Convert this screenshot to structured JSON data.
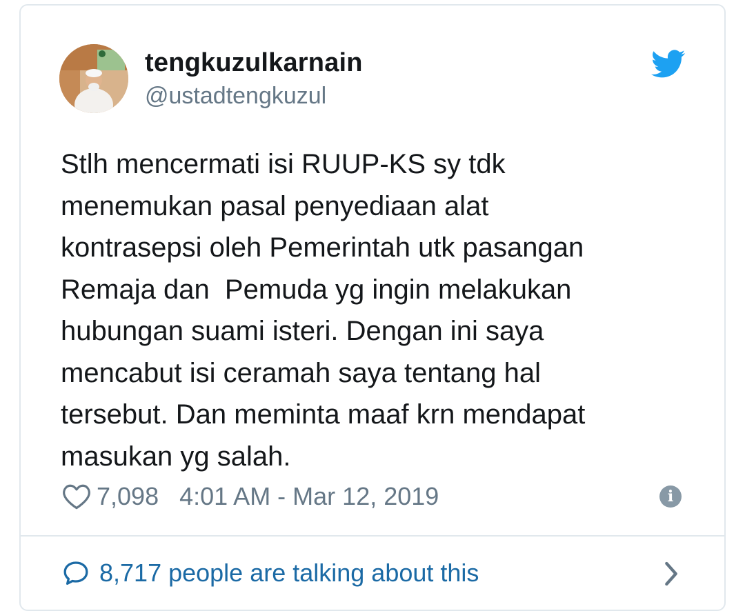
{
  "user": {
    "display_name": "tengkuzulkarnain",
    "handle": "@ustadtengkuzul",
    "avatar_icon": "profile-photo"
  },
  "tweet": {
    "text": "Stlh mencermati isi RUUP-KS sy tdk\nmenemukan pasal penyediaan alat\nkontrasepsi oleh Pemerintah utk pasangan\nRemaja dan  Pemuda yg ingin melakukan\nhubungan suami isteri. Dengan ini saya\nmencabut isi ceramah saya tentang hal\ntersebut. Dan meminta maaf krn mendapat\nmasukan yg salah."
  },
  "meta": {
    "like_icon": "heart-outline",
    "likes": "7,098",
    "timestamp": "4:01 AM - Mar 12, 2019",
    "info_icon": "info-circle"
  },
  "footer": {
    "talking_icon": "speech-bubble",
    "talking_text": "8,717 people are talking about this",
    "chevron_icon": "chevron-right"
  },
  "colors": {
    "twitter_blue": "#1da1f2",
    "link_blue": "#1b6aa5",
    "text": "#14171a",
    "secondary": "#657786",
    "border": "#e1e8ed"
  }
}
